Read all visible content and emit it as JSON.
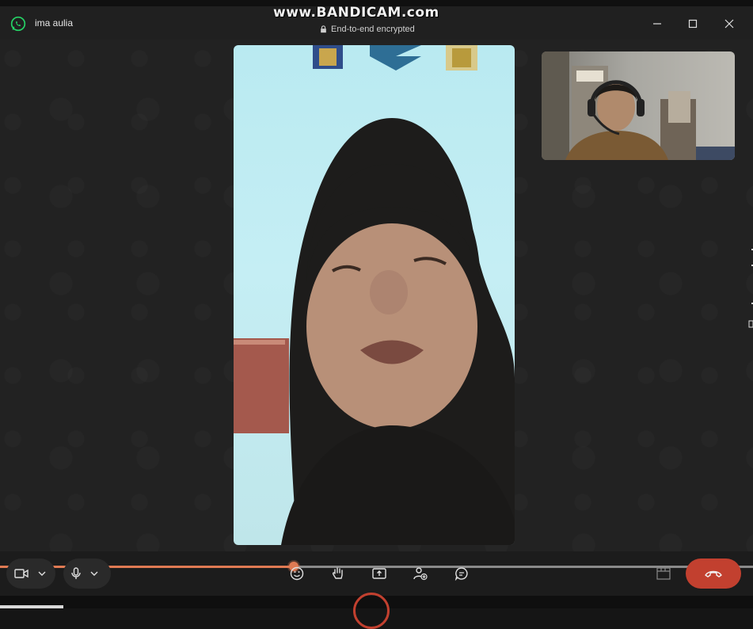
{
  "window": {
    "title": "ima aulia",
    "watermark": "www.BANDICAM.com",
    "encryption_notice": "End-to-end encrypted"
  },
  "icons": {
    "app_logo": "whatsapp-icon",
    "lock": "lock-icon",
    "minimize": "minimize-icon",
    "maximize": "maximize-icon",
    "close": "close-icon",
    "camera": "video-camera-icon",
    "mic": "microphone-icon",
    "emoji": "emoji-icon",
    "raise_hand": "raise-hand-icon",
    "share_screen": "share-screen-icon",
    "add_participant": "add-participant-icon",
    "chat": "chat-icon",
    "layout": "layout-icon",
    "end_call": "end-call-icon"
  },
  "call": {
    "progress_fraction": 0.39
  },
  "colors": {
    "accent": "#e07a53",
    "end_call": "#c2402f",
    "whatsapp": "#25d366"
  }
}
